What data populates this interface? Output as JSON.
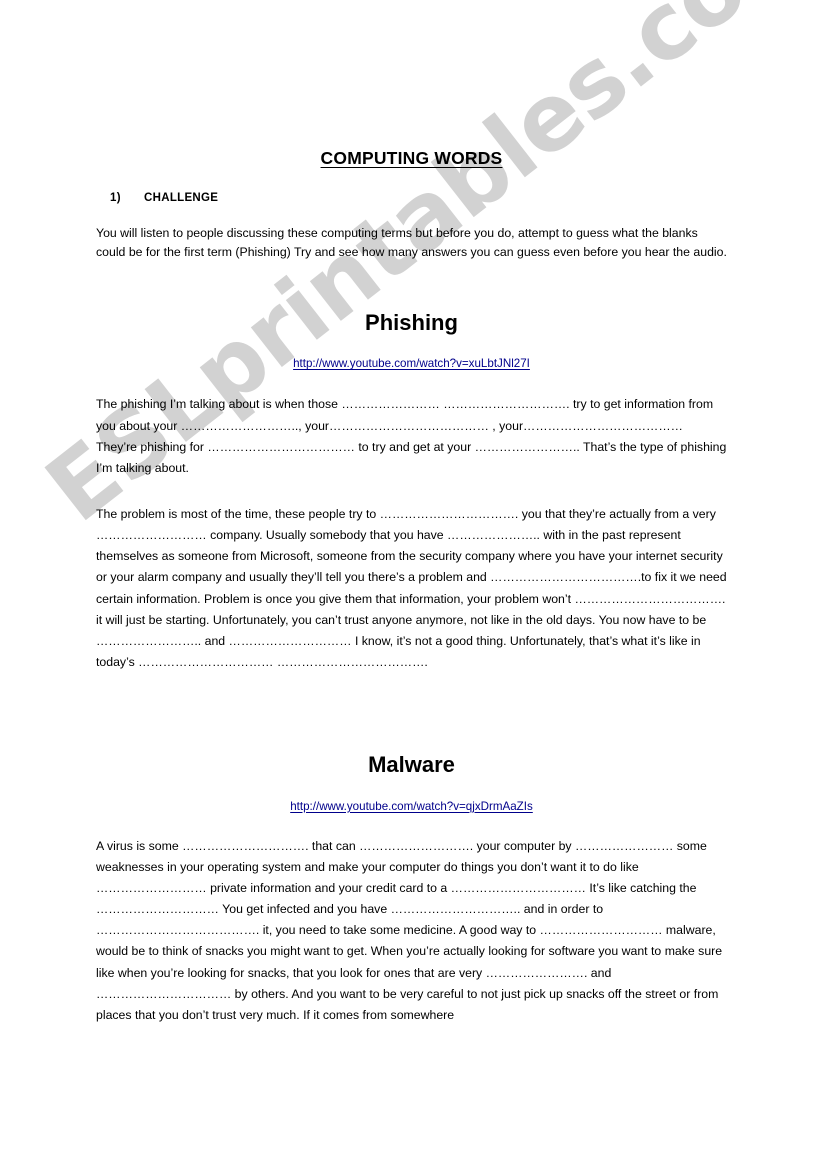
{
  "document": {
    "title": "COMPUTING WORDS",
    "section": {
      "number": "1)",
      "label": "CHALLENGE"
    },
    "intro": "You will listen to people discussing these computing terms but before you do, attempt to guess what the blanks could be for the first term (Phishing) Try and see how many answers you can guess even before you hear the audio."
  },
  "watermark": {
    "text": "ESLprintables.com",
    "color": "#d2d2d2"
  },
  "link_color": "#00008b",
  "sections": {
    "phishing": {
      "heading": "Phishing",
      "url": "http://www.youtube.com/watch?v=xuLbtJNl27I",
      "paragraph_1": "The phishing I’m talking about is when those ……………………    …………………………. try to get information from you about your ……………………….., your………………………………… , your………………………………… They’re phishing for ……………………………… to try and get at your …………………….. That’s the type of phishing I’m talking about.",
      "paragraph_2": "The problem is most of the time, these people try to ……………………………. you that they’re actually from a very ……………………… company. Usually somebody that you have ………………….. with in the past represent themselves as someone from Microsoft, someone from the security company where you have your internet security or your alarm company and usually they’ll tell you there’s a problem and ……………………………….to fix it we need certain information. Problem is once you give them that information, your problem won’t ………………………………. it will just be starting. Unfortunately, you can’t trust anyone anymore, not like in the old days. You now have to be …………………….. and ………………………… I know, it’s not a good thing. Unfortunately, that’s what it’s like in today’s ……………………………   ………………………………."
    },
    "malware": {
      "heading": "Malware",
      "url": "http://www.youtube.com/watch?v=qjxDrmAaZIs",
      "paragraph_1": "A virus is some …………………………. that can ………………………. your computer by …………………… some weaknesses in your operating system and make your computer do things you don’t want it to do like ……………………… private information and your credit card to a …………………………… It’s like catching the ………………………… You get infected and you have ………………………….. and in order to …………………………………. it, you need to take some medicine. A good way to ………………………… malware, would be to think of snacks you might want to get.  When you’re actually looking for software you want to make sure like when you’re looking for snacks, that you look for ones that are very …………………….  and …………………………… by others. And you want to be very careful to not just pick up snacks off the street or from places that you don’t trust very much. If it comes from somewhere"
    }
  }
}
